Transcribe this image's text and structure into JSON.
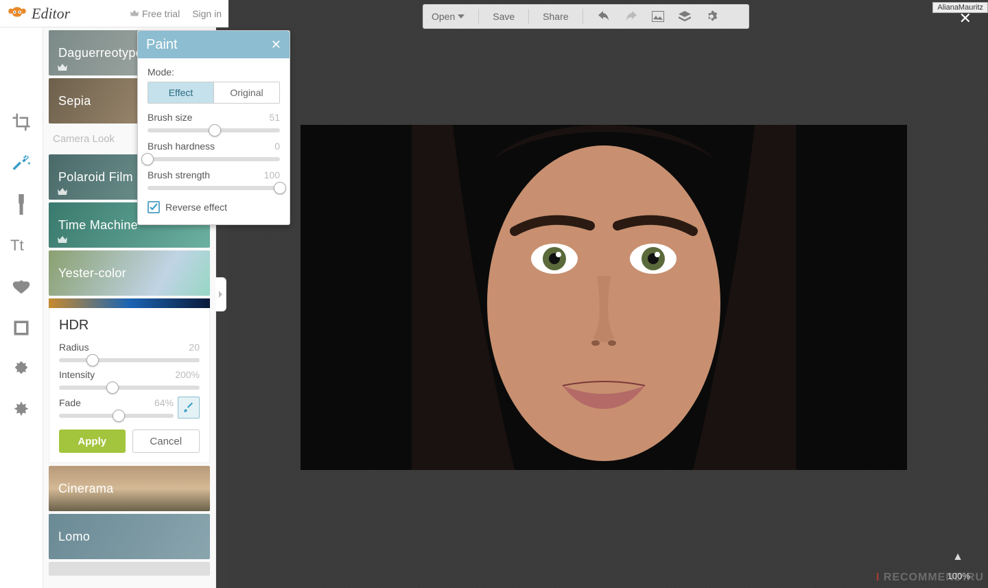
{
  "header": {
    "logo_text": "Editor",
    "free_trial": "Free trial",
    "sign_in": "Sign in"
  },
  "tools": [
    "crop",
    "magic",
    "touchup",
    "text",
    "overlays",
    "frames",
    "textures",
    "themes"
  ],
  "effects": {
    "items": [
      {
        "label": "Daguerreotype"
      },
      {
        "label": "Sepia"
      }
    ],
    "section_label": "Camera Look",
    "items2": [
      {
        "label": "Polaroid Film"
      },
      {
        "label": "Time Machine"
      },
      {
        "label": "Yester-color"
      }
    ],
    "hdr": {
      "title": "HDR",
      "radius_label": "Radius",
      "radius_value": "20",
      "radius_pct": 24,
      "intensity_label": "Intensity",
      "intensity_value": "200%",
      "intensity_pct": 38,
      "fade_label": "Fade",
      "fade_value": "64%",
      "fade_pct": 52,
      "apply": "Apply",
      "cancel": "Cancel"
    },
    "items3": [
      {
        "label": "Cinerama"
      },
      {
        "label": "Lomo"
      }
    ]
  },
  "paint_panel": {
    "title": "Paint",
    "mode_label": "Mode:",
    "mode_effect": "Effect",
    "mode_original": "Original",
    "brush_size_label": "Brush size",
    "brush_size_value": "51",
    "brush_size_pct": 51,
    "brush_hard_label": "Brush hardness",
    "brush_hard_value": "0",
    "brush_hard_pct": 0,
    "brush_strength_label": "Brush strength",
    "brush_strength_value": "100",
    "brush_strength_pct": 100,
    "reverse_label": "Reverse effect",
    "reverse_checked": true
  },
  "toolbar": {
    "open": "Open",
    "save": "Save",
    "share": "Share"
  },
  "overlay": {
    "username": "AlianaMauritz",
    "zoom": "100%",
    "brand1": "I",
    "brand2": "RECOMMEND",
    "brand3": ".RU"
  }
}
